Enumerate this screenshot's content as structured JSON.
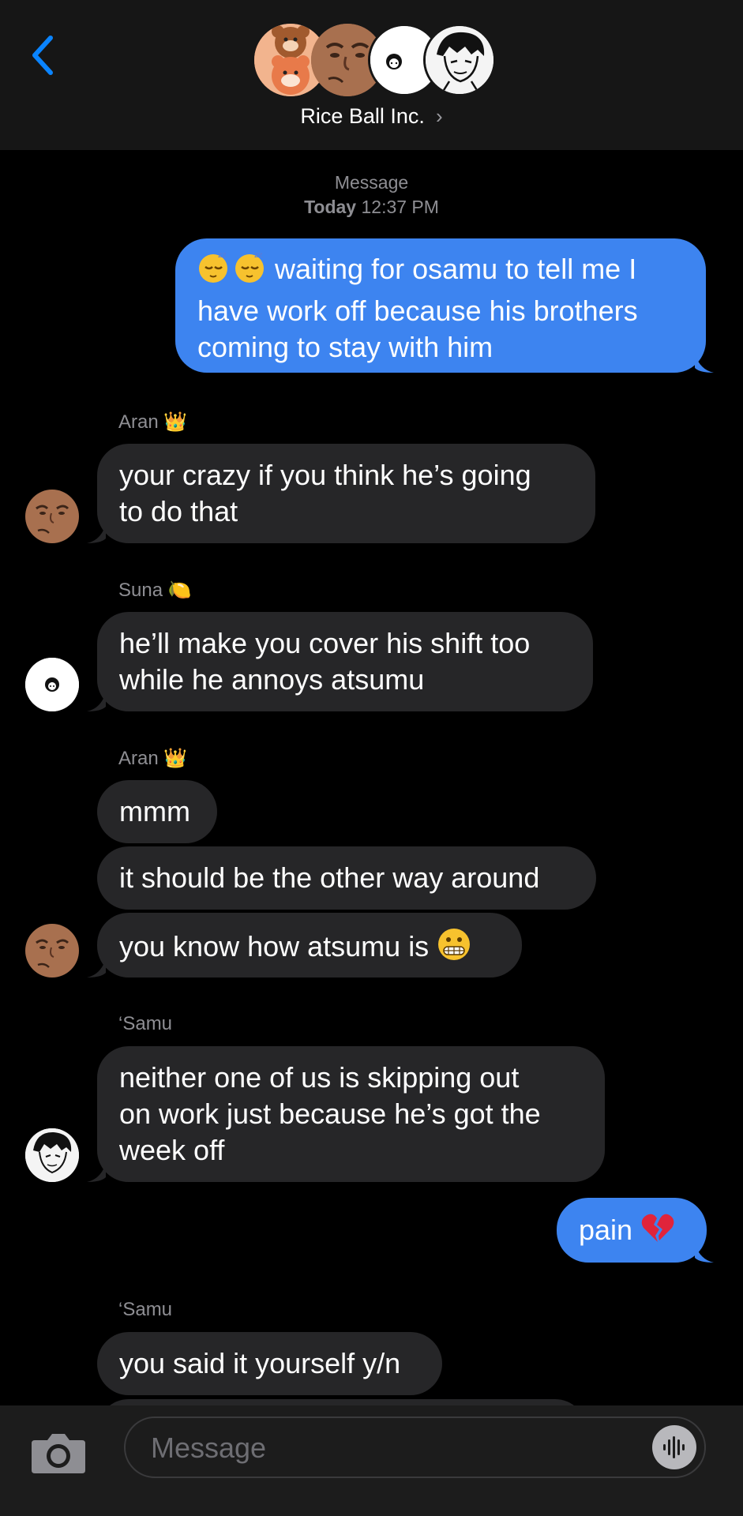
{
  "header": {
    "title": "Rice Ball Inc.",
    "title_chevron": "›",
    "back_icon": "chevron-left-icon"
  },
  "timestamp": {
    "service": "Message",
    "day": "Today",
    "time": "12:37 PM"
  },
  "messages": [
    {
      "id": "m1",
      "direction": "outgoing",
      "lines": [
        "waiting for osamu to tell me I",
        "have work off because his brothers",
        "coming to stay with him"
      ],
      "emoji_prefix": "😴😴"
    },
    {
      "id": "m2",
      "sender": "Aran 👑",
      "direction": "incoming",
      "lines": [
        "your crazy if you think he’s going",
        "to do that"
      ]
    },
    {
      "id": "m3",
      "sender": "Suna 🍋",
      "direction": "incoming",
      "lines": [
        "he’ll make you cover his shift too",
        "while he annoys atsumu"
      ]
    },
    {
      "id": "m4",
      "sender": "Aran 👑",
      "direction": "incoming",
      "lines": [
        "mmm"
      ]
    },
    {
      "id": "m5",
      "direction": "incoming",
      "lines": [
        "it should be the other way around"
      ]
    },
    {
      "id": "m6",
      "direction": "incoming",
      "lines": [
        "you know how atsumu is"
      ],
      "emoji_suffix": "😬"
    },
    {
      "id": "m7",
      "sender": "‘Samu",
      "direction": "incoming",
      "lines": [
        "neither one of us is skipping out",
        "on work just because he’s got the",
        "week off"
      ]
    },
    {
      "id": "m8",
      "direction": "outgoing",
      "lines": [
        "pain"
      ],
      "emoji_suffix": "💔"
    },
    {
      "id": "m9",
      "sender": "‘Samu",
      "direction": "incoming",
      "lines": [
        "you said it yourself y/n"
      ]
    }
  ],
  "composer": {
    "placeholder": "Message",
    "camera_icon": "camera-icon",
    "audio_icon": "audio-waveform-icon"
  },
  "colors": {
    "outgoing_bubble": "#3d84f0",
    "incoming_bubble": "#262628",
    "accent": "#0a84ff"
  }
}
